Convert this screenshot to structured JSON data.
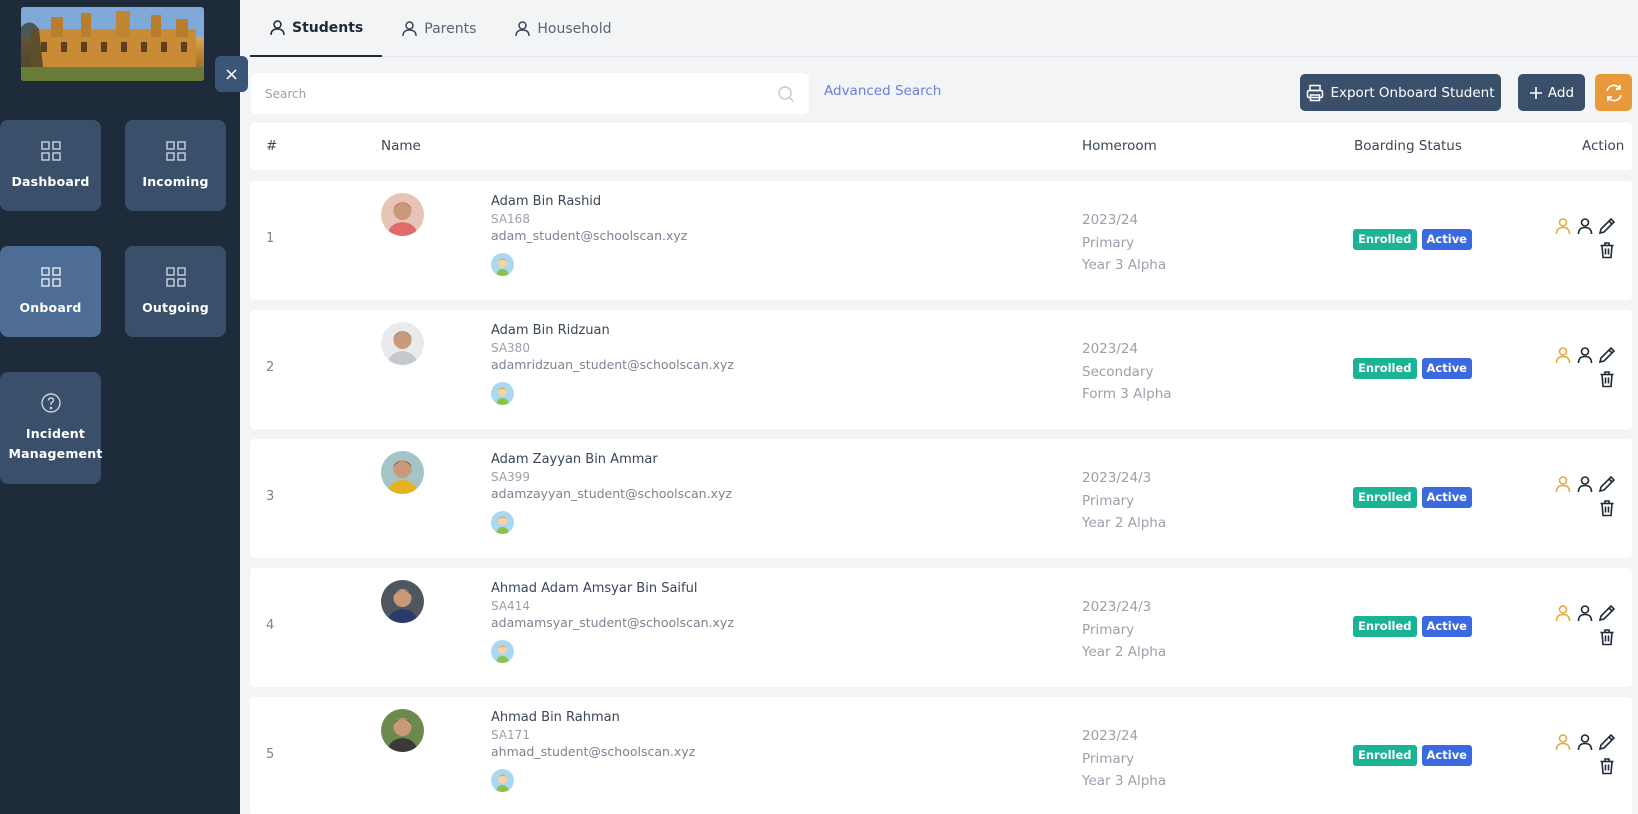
{
  "sidebar": {
    "close_label": "×",
    "tiles": [
      {
        "label": "Dashboard",
        "icon": "grid-icon"
      },
      {
        "label": "Incoming",
        "icon": "grid-icon"
      },
      {
        "label": "Onboard",
        "icon": "grid-icon",
        "active": true
      },
      {
        "label": "Outgoing",
        "icon": "grid-icon"
      },
      {
        "label_line1": "Incident",
        "label_line2": "Management",
        "icon": "help-circle-icon"
      }
    ]
  },
  "tabs": [
    {
      "label": "Students",
      "active": true
    },
    {
      "label": "Parents"
    },
    {
      "label": "Household"
    }
  ],
  "search": {
    "placeholder": "Search",
    "advanced_label": "Advanced Search"
  },
  "toolbar": {
    "export_label": "Export Onboard Student",
    "add_label": "Add"
  },
  "table": {
    "headers": {
      "num": "#",
      "name": "Name",
      "homeroom": "Homeroom",
      "status": "Boarding Status",
      "action": "Action"
    },
    "rows": [
      {
        "num": "1",
        "name": "Adam Bin Rashid",
        "id": "SA168",
        "email": "adam_student@schoolscan.xyz",
        "home1": "2023/24",
        "home2": "Primary",
        "home3": "Year 3 Alpha",
        "badge1": "Enrolled",
        "badge2": "Active"
      },
      {
        "num": "2",
        "name": "Adam Bin Ridzuan",
        "id": "SA380",
        "email": "adamridzuan_student@schoolscan.xyz",
        "home1": "2023/24",
        "home2": "Secondary",
        "home3": "Form 3 Alpha",
        "badge1": "Enrolled",
        "badge2": "Active"
      },
      {
        "num": "3",
        "name": "Adam Zayyan Bin Ammar",
        "id": "SA399",
        "email": "adamzayyan_student@schoolscan.xyz",
        "home1": "2023/24/3",
        "home2": "Primary",
        "home3": "Year 2 Alpha",
        "badge1": "Enrolled",
        "badge2": "Active"
      },
      {
        "num": "4",
        "name": "Ahmad Adam Amsyar Bin Saiful",
        "id": "SA414",
        "email": "adamamsyar_student@schoolscan.xyz",
        "home1": "2023/24/3",
        "home2": "Primary",
        "home3": "Year 2 Alpha",
        "badge1": "Enrolled",
        "badge2": "Active"
      },
      {
        "num": "5",
        "name": "Ahmad Bin Rahman",
        "id": "SA171",
        "email": "ahmad_student@schoolscan.xyz",
        "home1": "2023/24",
        "home2": "Primary",
        "home3": "Year 3 Alpha",
        "badge1": "Enrolled",
        "badge2": "Active"
      }
    ]
  },
  "colors": {
    "sidebar_bg": "#1e2b3a",
    "tile_bg": "#3a4f6a",
    "tile_active": "#4d6d95",
    "enrolled": "#1ab394",
    "active": "#3b6ae0",
    "refresh": "#e8993a",
    "link": "#6c7fd8"
  }
}
